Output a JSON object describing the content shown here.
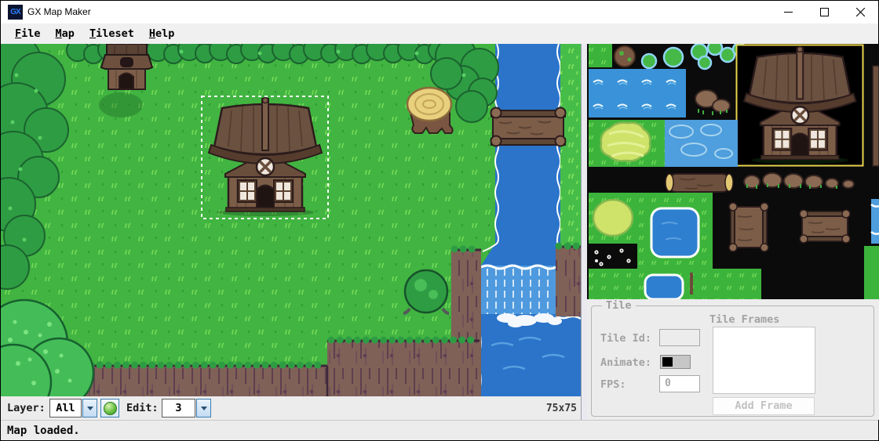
{
  "window": {
    "title": "GX Map Maker",
    "icon_text": "GX"
  },
  "menu": {
    "items": [
      {
        "label": "File"
      },
      {
        "label": "Map"
      },
      {
        "label": "Tileset"
      },
      {
        "label": "Help"
      }
    ]
  },
  "toolbar": {
    "layer_label": "Layer:",
    "layer_value": "All",
    "edit_label": "Edit:",
    "edit_value": "3",
    "map_size": "75x75"
  },
  "status": {
    "text": "Map loaded."
  },
  "tile_panel": {
    "group_title": "Tile",
    "tile_id_label": "Tile Id:",
    "tile_id_value": "",
    "animate_label": "Animate:",
    "fps_label": "FPS:",
    "fps_value": "0",
    "frames_label": "Tile Frames",
    "add_frame_label": "Add Frame"
  },
  "colors": {
    "grass": "#41b441",
    "tree_dark": "#2e9c43",
    "water": "#2b74ca",
    "cliff": "#7f6157",
    "wood": "#6b5140",
    "selection": "#ffffff",
    "tile_selection": "#e8d44d",
    "accent_border": "#3c7fb1"
  }
}
